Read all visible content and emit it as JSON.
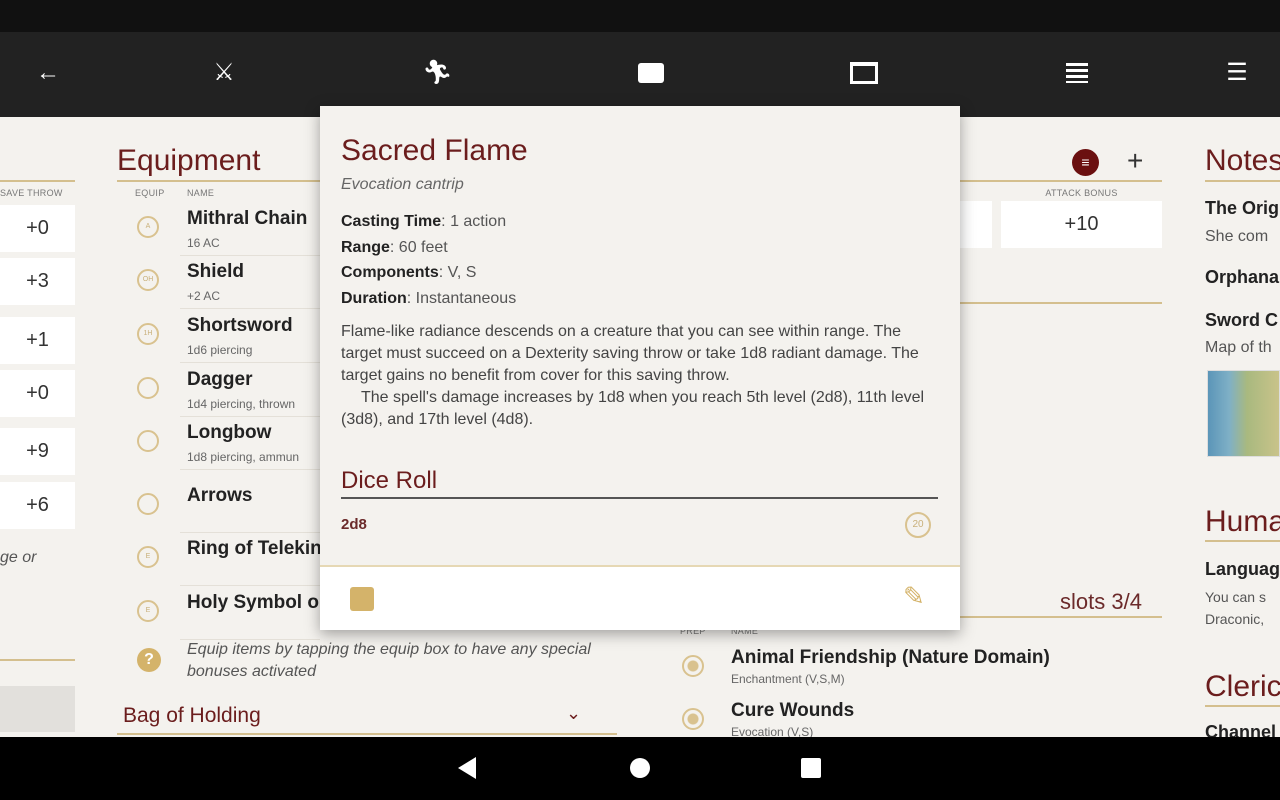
{
  "toolbar": {
    "icons": [
      "back-arrow-icon",
      "crossed-swords-icon",
      "running-figure-icon",
      "chest-icon",
      "spellbook-icon",
      "notes-icon",
      "menu-icon"
    ]
  },
  "saves": {
    "header": "SAVE THROW",
    "values": [
      "+0",
      "+3",
      "+1",
      "+0",
      "+9",
      "+6"
    ],
    "trailing_text": "ge or"
  },
  "equipment": {
    "title": "Equipment",
    "col_equip": "EQUIP",
    "col_name": "NAME",
    "items": [
      {
        "name": "Mithral Chain",
        "sub": "16 AC",
        "badge": "A"
      },
      {
        "name": "Shield",
        "sub": "+2 AC",
        "badge": "OH"
      },
      {
        "name": "Shortsword",
        "sub": "1d6 piercing",
        "badge": "1H"
      },
      {
        "name": "Dagger",
        "sub": "1d4 piercing, thrown",
        "badge": ""
      },
      {
        "name": "Longbow",
        "sub": "1d8 piercing, ammun",
        "badge": ""
      },
      {
        "name": "Arrows",
        "sub": "",
        "badge": ""
      },
      {
        "name": "Ring of Telekin",
        "sub": "",
        "badge": "E"
      },
      {
        "name": "Holy Symbol o",
        "sub": "",
        "badge": "E"
      }
    ],
    "help": "Equip items by tapping the equip box to have any special bonuses activated",
    "bag": "Bag of Holding"
  },
  "spells": {
    "attack_header": "ATTACK BONUS",
    "attack_value": "+10",
    "slots": "slots 3/4",
    "col_prep": "PREP",
    "col_name": "NAME",
    "items": [
      {
        "name": "Animal Friendship (Nature Domain)",
        "sub": "Enchantment (V,S,M)"
      },
      {
        "name": "Cure Wounds",
        "sub": "Evocation (V,S)"
      }
    ]
  },
  "popup": {
    "title": "Sacred Flame",
    "subtitle": "Evocation cantrip",
    "props": [
      {
        "k": "Casting Time",
        "v": ": 1 action"
      },
      {
        "k": "Range",
        "v": ": 60 feet"
      },
      {
        "k": "Components",
        "v": ": V, S"
      },
      {
        "k": "Duration",
        "v": ": Instantaneous"
      }
    ],
    "desc1": "Flame-like radiance descends on a creature that you can see within range. The target must succeed on a Dexterity saving throw or take 1d8 radiant damage. The target gains no benefit from cover for this saving throw.",
    "desc2": "The spell's damage increases by 1d8 when you reach 5th level (2d8), 11th level (3d8), and 17th level (4d8).",
    "dice_title": "Dice Roll",
    "dice_value": "2d8",
    "d20": "20"
  },
  "notes": {
    "title": "Notes",
    "lines": [
      {
        "t": "The Orig",
        "s": "She com"
      },
      {
        "t": "Orphana",
        "s": ""
      },
      {
        "t": "Sword C",
        "s": "Map of th"
      }
    ],
    "race_title": "Huma",
    "lang_t": "Languag",
    "lang_s1": "You can s",
    "lang_s2": "Draconic,",
    "class_title": "Cleric",
    "class_t": "Channel"
  },
  "colors": {
    "accent": "#6b1d1d",
    "gold": "#d4bf8e",
    "bg": "#f4f2ee"
  }
}
